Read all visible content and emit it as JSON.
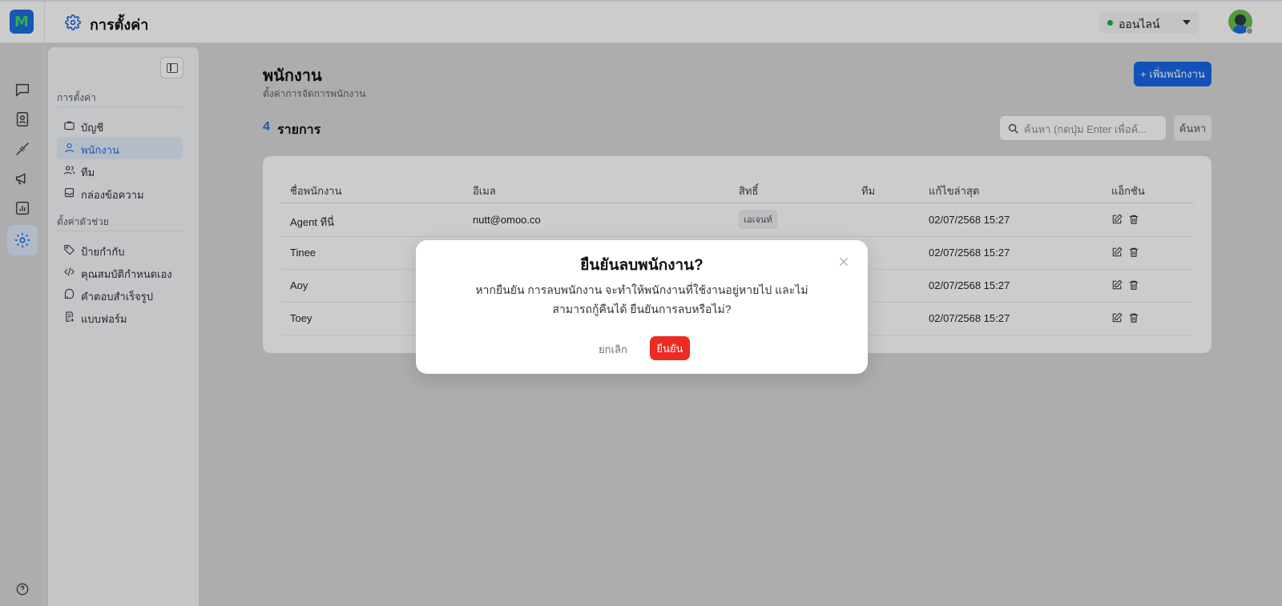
{
  "header": {
    "title": "การตั้งค่า",
    "status": "ออนไลน์",
    "colors": {
      "accent": "#1f6fe0",
      "online": "#1fae3a"
    }
  },
  "rail": {
    "icons": [
      "chat-icon",
      "contacts-icon",
      "integrations-icon",
      "broadcast-icon",
      "reports-icon",
      "settings-icon",
      "help-icon"
    ]
  },
  "sidebar": {
    "section1": "การตั้งค่า",
    "section2": "ตั้งค่าตัวช่วย",
    "items": [
      {
        "label": "บัญชี",
        "icon": "briefcase-icon"
      },
      {
        "label": "พนักงาน",
        "icon": "user-icon"
      },
      {
        "label": "ทีม",
        "icon": "users-icon"
      },
      {
        "label": "กล่องข้อความ",
        "icon": "inbox-icon"
      }
    ],
    "helper_items": [
      {
        "label": "ป้ายกำกับ",
        "icon": "tag-icon"
      },
      {
        "label": "คุณสมบัติกำหนดเอง",
        "icon": "code-icon"
      },
      {
        "label": "คำตอบสำเร็จรูป",
        "icon": "quick-reply-icon"
      },
      {
        "label": "แบบฟอร์ม",
        "icon": "form-icon"
      }
    ]
  },
  "main": {
    "title": "พนักงาน",
    "subtitle": "ตั้งค่าการจัดการพนักงาน",
    "add_button": "+ เพิ่มพนักงาน",
    "count": "4",
    "count_label": "รายการ",
    "search_placeholder": "ค้นหา (กดปุ่ม Enter เพื่อค้...",
    "search_button": "ค้นหา",
    "table": {
      "headers": [
        "ชื่อพนักงาน",
        "อีเมล",
        "สิทธิ์",
        "ทีม",
        "แก้ไขล่าสุด",
        "แอ็กชัน"
      ],
      "rows": [
        {
          "name": "Agent ทีนี่",
          "email": "nutt@omoo.co",
          "role": "เอเจนท์",
          "updated": "02/07/2568 15:27"
        },
        {
          "name": "Tinee",
          "email": "",
          "role": "",
          "updated": "02/07/2568 15:27"
        },
        {
          "name": "Aoy",
          "email": "",
          "role": "",
          "updated": "02/07/2568 15:27"
        },
        {
          "name": "Toey",
          "email": "",
          "role": "",
          "updated": "02/07/2568 15:27"
        }
      ]
    }
  },
  "modal": {
    "title": "ยืนยันลบพนักงาน?",
    "message": "หากยืนยัน การลบพนักงาน จะทำให้พนักงานที่ใช้งานอยู่หายไป และไม่สามารถกู้คืนได้ ยืนยันการลบหรือไม่?",
    "cancel": "ยกเลิก",
    "confirm": "ยืนยัน",
    "colors": {
      "confirm": "#ec2b22"
    }
  }
}
